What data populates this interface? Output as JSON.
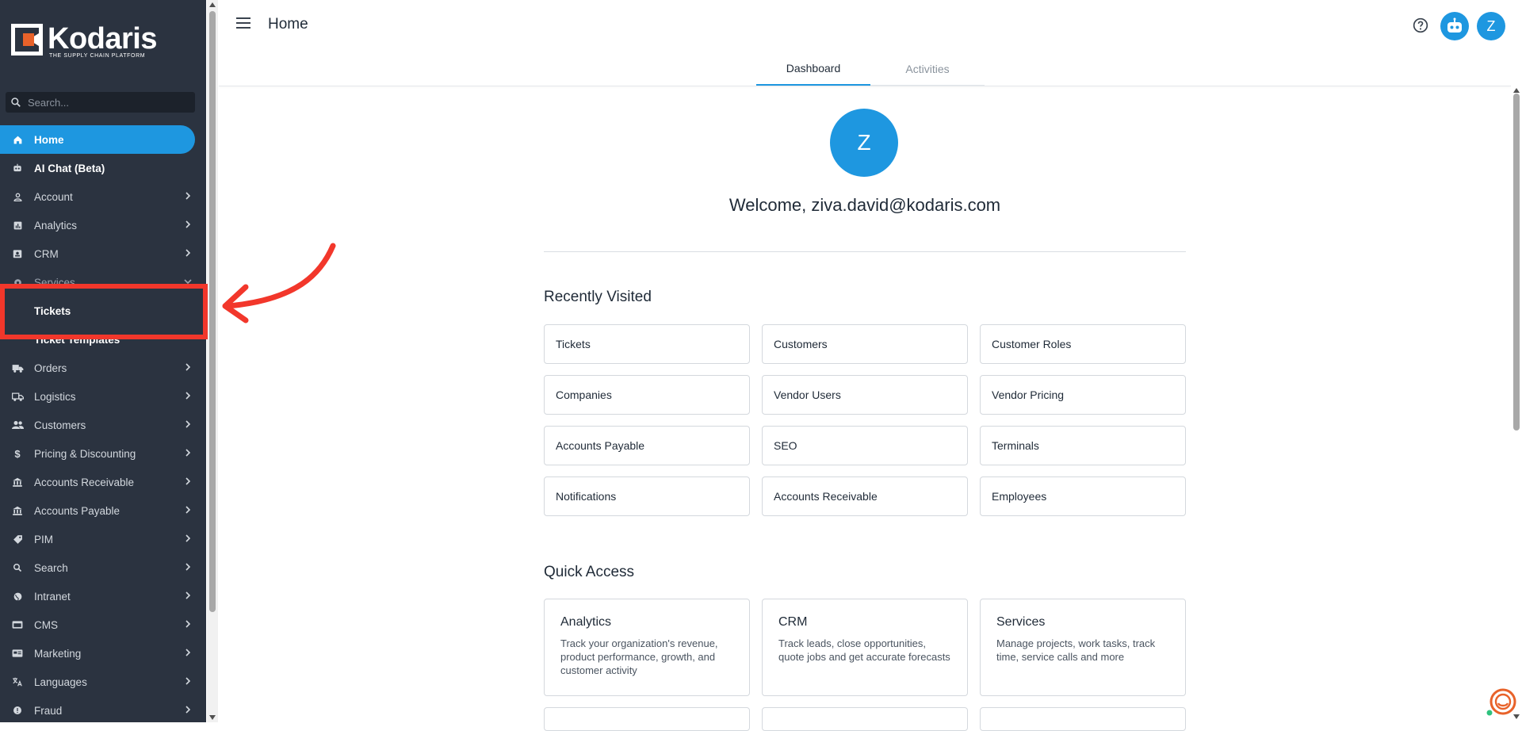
{
  "brand": {
    "name": "Kodaris",
    "tagline": "THE SUPPLY CHAIN PLATFORM",
    "accent": "#1e97e0",
    "sidebar_bg": "#2b3340",
    "highlight": "#f2372b"
  },
  "sidebar": {
    "search_placeholder": "Search...",
    "items": [
      {
        "label": "Home",
        "icon": "home-icon",
        "state": "active",
        "chevron": false
      },
      {
        "label": "AI Chat (Beta)",
        "icon": "robot-icon",
        "state": "white",
        "chevron": false
      },
      {
        "label": "Account",
        "icon": "person-icon",
        "state": "",
        "chevron": true
      },
      {
        "label": "Analytics",
        "icon": "chart-icon",
        "state": "",
        "chevron": true
      },
      {
        "label": "CRM",
        "icon": "contact-card-icon",
        "state": "",
        "chevron": true
      },
      {
        "label": "Services",
        "icon": "gear-icon",
        "state": "dim",
        "chevron": true
      },
      {
        "label": "Tickets",
        "icon": "",
        "state": "white sub",
        "chevron": false
      },
      {
        "label": "Ticket Templates",
        "icon": "",
        "state": "white sub",
        "chevron": false
      },
      {
        "label": "Orders",
        "icon": "truck-icon",
        "state": "",
        "chevron": true
      },
      {
        "label": "Logistics",
        "icon": "delivery-truck-icon",
        "state": "",
        "chevron": true
      },
      {
        "label": "Customers",
        "icon": "people-icon",
        "state": "",
        "chevron": true
      },
      {
        "label": "Pricing & Discounting",
        "icon": "dollar-icon",
        "state": "",
        "chevron": true
      },
      {
        "label": "Accounts Receivable",
        "icon": "bank-icon",
        "state": "",
        "chevron": true
      },
      {
        "label": "Accounts Payable",
        "icon": "bank-icon",
        "state": "",
        "chevron": true
      },
      {
        "label": "PIM",
        "icon": "tag-icon",
        "state": "",
        "chevron": true
      },
      {
        "label": "Search",
        "icon": "search-icon",
        "state": "",
        "chevron": true
      },
      {
        "label": "Intranet",
        "icon": "globe-icon",
        "state": "",
        "chevron": true
      },
      {
        "label": "CMS",
        "icon": "web-icon",
        "state": "",
        "chevron": true
      },
      {
        "label": "Marketing",
        "icon": "megaphone-icon",
        "state": "",
        "chevron": true
      },
      {
        "label": "Languages",
        "icon": "translate-icon",
        "state": "",
        "chevron": true
      },
      {
        "label": "Fraud",
        "icon": "alert-icon",
        "state": "",
        "chevron": true
      }
    ]
  },
  "header": {
    "title": "Home",
    "avatar_initial": "Z"
  },
  "tabs": [
    {
      "label": "Dashboard",
      "active": true
    },
    {
      "label": "Activities",
      "active": false
    }
  ],
  "welcome": {
    "initial": "Z",
    "text": "Welcome, ziva.david@kodaris.com"
  },
  "recently_visited": {
    "title": "Recently Visited",
    "items": [
      "Tickets",
      "Customers",
      "Customer Roles",
      "Companies",
      "Vendor Users",
      "Vendor Pricing",
      "Accounts Payable",
      "SEO",
      "Terminals",
      "Notifications",
      "Accounts Receivable",
      "Employees"
    ]
  },
  "quick_access": {
    "title": "Quick Access",
    "items": [
      {
        "title": "Analytics",
        "desc": "Track your organization's revenue, product performance, growth, and customer activity"
      },
      {
        "title": "CRM",
        "desc": "Track leads, close opportunities, quote jobs and get accurate forecasts"
      },
      {
        "title": "Services",
        "desc": "Manage projects, work tasks, track time, service calls and more"
      }
    ]
  }
}
